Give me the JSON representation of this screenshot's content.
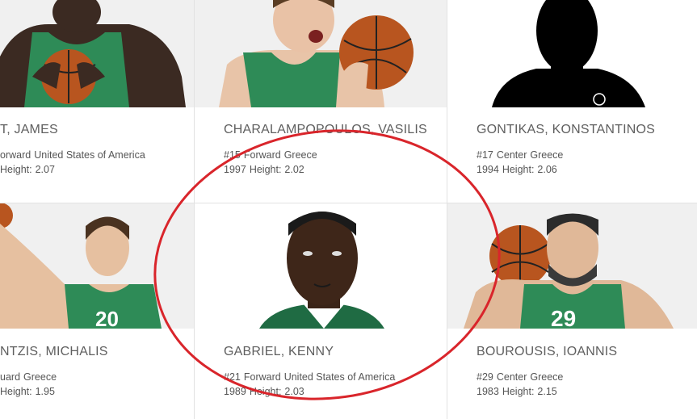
{
  "colors": {
    "jersey_green": "#2e8b57",
    "jersey_dark": "#1f6b43",
    "annotation_red": "#d9252b",
    "text_gray": "#5f5f5f"
  },
  "players": [
    {
      "name": "T, JAMES",
      "number": "",
      "position": "orward",
      "country": "United States of America",
      "year": "",
      "height_label": "Height:",
      "height": "2.07",
      "jersey": ""
    },
    {
      "name": "CHARALAMPOPOULOS, VASILIS",
      "number": "#15",
      "position": "Forward",
      "country": "Greece",
      "year": "1997",
      "height_label": "Height:",
      "height": "2.02",
      "jersey": ""
    },
    {
      "name": "GONTIKAS, KONSTANTINOS",
      "number": "#17",
      "position": "Center",
      "country": "Greece",
      "year": "1994",
      "height_label": "Height:",
      "height": "2.06",
      "jersey": ""
    },
    {
      "name": "NTZIS, MICHALIS",
      "number": "",
      "position": "uard",
      "country": "Greece",
      "year": "",
      "height_label": "Height:",
      "height": "1.95",
      "jersey": "20"
    },
    {
      "name": "GABRIEL, KENNY",
      "number": "#21",
      "position": "Forward",
      "country": "United States of America",
      "year": "1989",
      "height_label": "Height:",
      "height": "2.03",
      "jersey": ""
    },
    {
      "name": "BOUROUSIS, IOANNIS",
      "number": "#29",
      "position": "Center",
      "country": "Greece",
      "year": "1983",
      "height_label": "Height:",
      "height": "2.15",
      "jersey": "29"
    }
  ]
}
